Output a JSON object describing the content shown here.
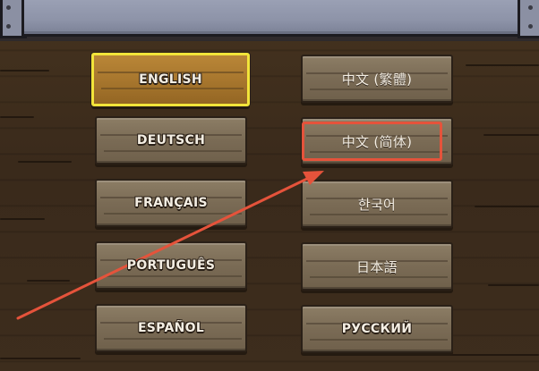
{
  "languages": {
    "left": [
      {
        "id": "english",
        "label": "ENGLISH",
        "selected": true
      },
      {
        "id": "deutsch",
        "label": "DEUTSCH",
        "selected": false
      },
      {
        "id": "francais",
        "label": "FRANÇAIS",
        "selected": false
      },
      {
        "id": "portugues",
        "label": "PORTUGUÊS",
        "selected": false
      },
      {
        "id": "espanol",
        "label": "ESPAÑOL",
        "selected": false
      }
    ],
    "right": [
      {
        "id": "chinese-traditional",
        "label": "中文 (繁體)",
        "selected": false
      },
      {
        "id": "chinese-simplified",
        "label": "中文 (简体)",
        "selected": false
      },
      {
        "id": "korean",
        "label": "한국어",
        "selected": false
      },
      {
        "id": "japanese",
        "label": "日本語",
        "selected": false
      },
      {
        "id": "russian",
        "label": "РУССКИЙ",
        "selected": false
      }
    ]
  },
  "annotation": {
    "highlight_color": "#e5533b",
    "highlighted_item": "chinese-simplified"
  },
  "colors": {
    "selected_border": "#f2e43a",
    "button_wood": "#7a6b55",
    "selected_wood": "#a8772e",
    "top_bar": "#8d93a8"
  }
}
